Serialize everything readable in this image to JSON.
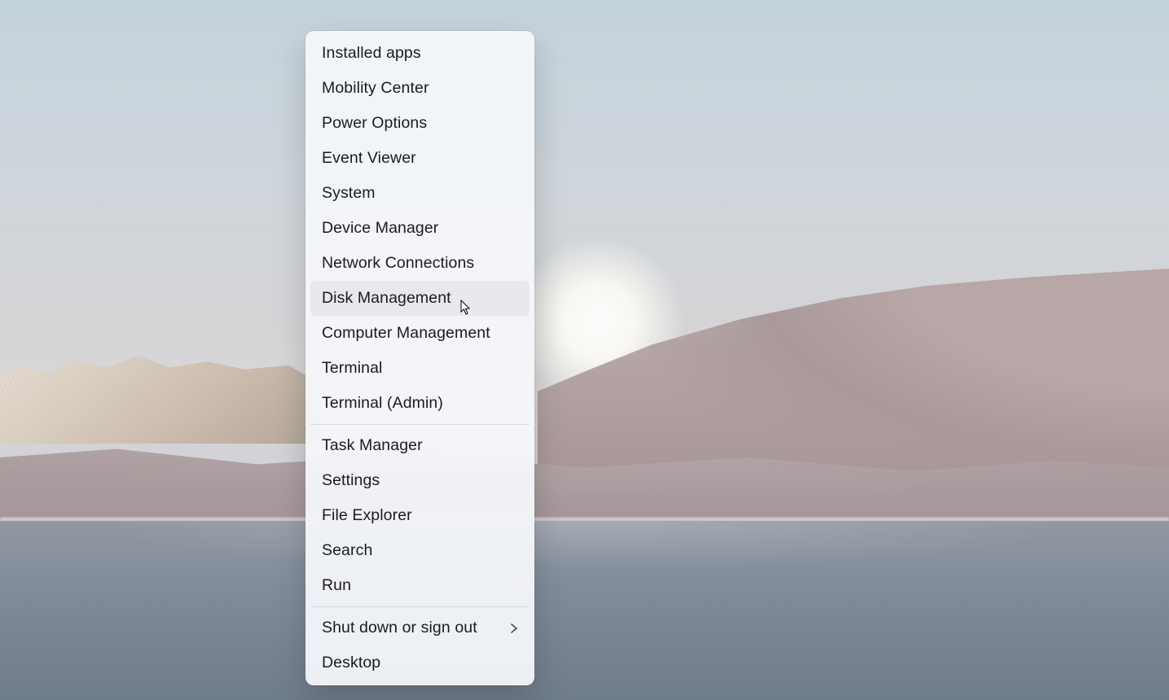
{
  "menu": {
    "groups": [
      {
        "items": [
          {
            "id": "installed-apps",
            "label": "Installed apps"
          },
          {
            "id": "mobility-center",
            "label": "Mobility Center"
          },
          {
            "id": "power-options",
            "label": "Power Options"
          },
          {
            "id": "event-viewer",
            "label": "Event Viewer"
          },
          {
            "id": "system",
            "label": "System"
          },
          {
            "id": "device-manager",
            "label": "Device Manager"
          },
          {
            "id": "network-connections",
            "label": "Network Connections"
          },
          {
            "id": "disk-management",
            "label": "Disk Management",
            "hovered": true
          },
          {
            "id": "computer-management",
            "label": "Computer Management"
          },
          {
            "id": "terminal",
            "label": "Terminal"
          },
          {
            "id": "terminal-admin",
            "label": "Terminal (Admin)"
          }
        ]
      },
      {
        "items": [
          {
            "id": "task-manager",
            "label": "Task Manager"
          },
          {
            "id": "settings",
            "label": "Settings"
          },
          {
            "id": "file-explorer",
            "label": "File Explorer"
          },
          {
            "id": "search",
            "label": "Search"
          },
          {
            "id": "run",
            "label": "Run"
          }
        ]
      },
      {
        "items": [
          {
            "id": "shut-down-sign-out",
            "label": "Shut down or sign out",
            "submenu": true
          },
          {
            "id": "desktop",
            "label": "Desktop"
          }
        ]
      }
    ]
  },
  "colors": {
    "menu_bg": "#f4f6fa",
    "menu_text": "#1b1b1b",
    "menu_hover_bg": "#e7e9ee",
    "separator": "rgba(0,0,0,0.10)"
  }
}
